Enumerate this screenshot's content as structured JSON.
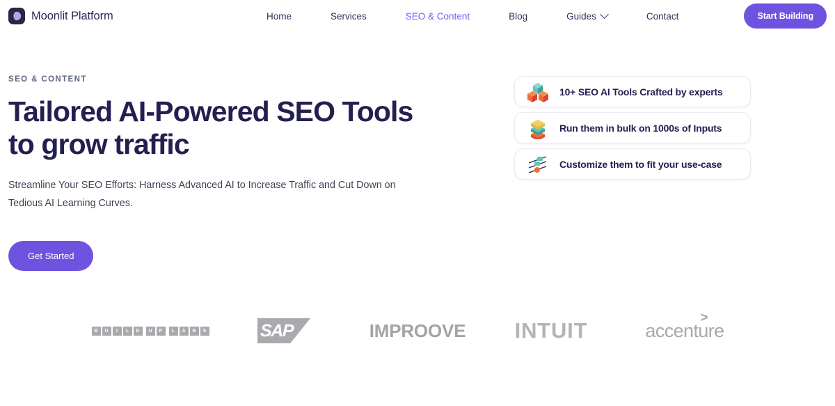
{
  "brand": {
    "name": "Moonlit Platform",
    "logo_icon": "moon-crescent-icon",
    "logo_bg": "#2b2640",
    "logo_accent": "#b3a4e8"
  },
  "nav": {
    "items": [
      {
        "label": "Home",
        "active": false,
        "has_chevron": false
      },
      {
        "label": "Services",
        "active": false,
        "has_chevron": false
      },
      {
        "label": "SEO & Content",
        "active": true,
        "has_chevron": false
      },
      {
        "label": "Blog",
        "active": false,
        "has_chevron": false
      },
      {
        "label": "Guides",
        "active": false,
        "has_chevron": true
      },
      {
        "label": "Contact",
        "active": false,
        "has_chevron": false
      }
    ],
    "cta_label": "Start Building",
    "cta_color": "#6f53e0",
    "active_color": "#7a5af0"
  },
  "hero": {
    "eyebrow": "SEO & CONTENT",
    "headline_line1": "Tailored AI-Powered SEO Tools",
    "headline_line2": "to grow traffic",
    "subhead_line1": "Streamline Your SEO Efforts: Harness Advanced AI to Increase Traffic and Cut Down on",
    "subhead_line2": "Tedious AI Learning Curves.",
    "cta_label": "Get Started",
    "headline_color": "#232050"
  },
  "feature_cards": [
    {
      "label": "10+ SEO AI Tools Crafted by experts",
      "icon": "cubes-icon"
    },
    {
      "label": "Run them in bulk on 1000s of Inputs",
      "icon": "layers-stack-icon"
    },
    {
      "label": "Customize them to fit your use-case",
      "icon": "sliders-icon"
    }
  ],
  "logo_strip": [
    {
      "name": "Build Up Labs",
      "icon": "buildup-labs-logo",
      "groups": [
        [
          "B",
          "U",
          "I",
          "L",
          "D"
        ],
        [
          "U",
          "P"
        ],
        [
          "L",
          "A",
          "B",
          "S"
        ]
      ]
    },
    {
      "name": "SAP",
      "icon": "sap-logo",
      "text": "SAP"
    },
    {
      "name": "Improove",
      "icon": "improove-logo",
      "text": "IMPROOVE"
    },
    {
      "name": "Intuit",
      "icon": "intuit-logo",
      "text": "INTUIT"
    },
    {
      "name": "Accenture",
      "icon": "accenture-logo",
      "text": "accenture",
      "arrow": "＞"
    }
  ],
  "palette": {
    "purple": "#6f53e0",
    "navy": "#232050",
    "teal": "#5fc3b8",
    "orange": "#ef6d30",
    "red": "#d8403a",
    "yellow": "#f2cf63",
    "logo_gray": "#a8a8ad"
  }
}
